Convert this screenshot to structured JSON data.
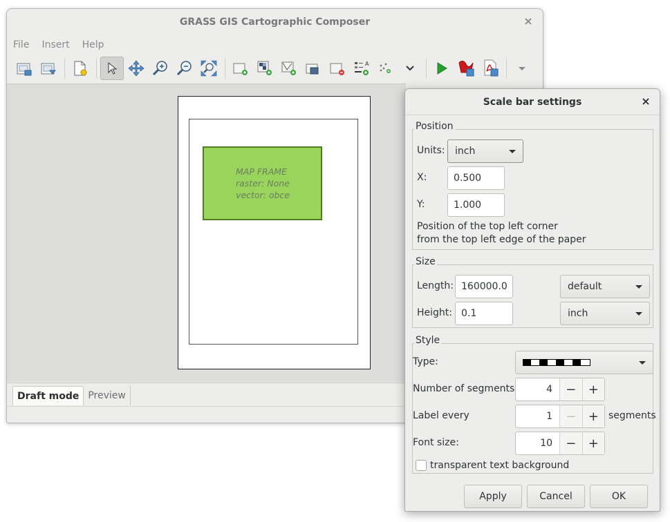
{
  "main_window": {
    "title": "GRASS GIS Cartographic Composer",
    "close_glyph": "×",
    "menu": [
      "File",
      "Insert",
      "Help"
    ],
    "toolbar_icons": [
      "page-setup-icon",
      "print-icon",
      "new-file-icon",
      "pointer-icon",
      "pan-icon",
      "zoom-in-icon",
      "zoom-out-icon",
      "zoom-all-icon",
      "add-map-icon",
      "add-raster-icon",
      "add-vector-icon",
      "delete-icon",
      "overlay-icon",
      "legend-icon",
      "scalebar-icon",
      "more-icon",
      "run-icon",
      "export-ps-icon",
      "export-pdf-icon",
      "overflow-icon"
    ],
    "map_frame": {
      "title": "MAP FRAME",
      "raster": "raster: None",
      "vector": "vector: obce"
    },
    "tabs": [
      "Draft mode",
      "Preview"
    ]
  },
  "dialog": {
    "title": "Scale bar settings",
    "close_glyph": "×",
    "position": {
      "label": "Position",
      "units_label": "Units:",
      "units_value": "inch",
      "x_label": "X:",
      "x_value": "0.500",
      "y_label": "Y:",
      "y_value": "1.000",
      "hint_line1": "Position of the top left corner",
      "hint_line2": "from the top left edge of the paper"
    },
    "size": {
      "label": "Size",
      "length_label": "Length:",
      "length_value": "160000.0",
      "length_unit": "default",
      "height_label": "Height:",
      "height_value": "0.1",
      "height_unit": "inch"
    },
    "style": {
      "label": "Style",
      "type_label": "Type:",
      "segments_label": "Number of segments:",
      "segments_value": "4",
      "label_every_label": "Label every",
      "label_every_value": "1",
      "label_every_suffix": "segments",
      "font_size_label": "Font size:",
      "font_size_value": "10",
      "minus": "−",
      "plus": "+",
      "transparent_label": "transparent text background"
    },
    "buttons": {
      "apply": "Apply",
      "cancel": "Cancel",
      "ok": "OK"
    }
  },
  "colors": {
    "map_frame_fill": "#99d55c",
    "map_frame_border": "#4e7d1d",
    "run_green": "#27a22f",
    "pdf_red": "#cc1a1a"
  }
}
